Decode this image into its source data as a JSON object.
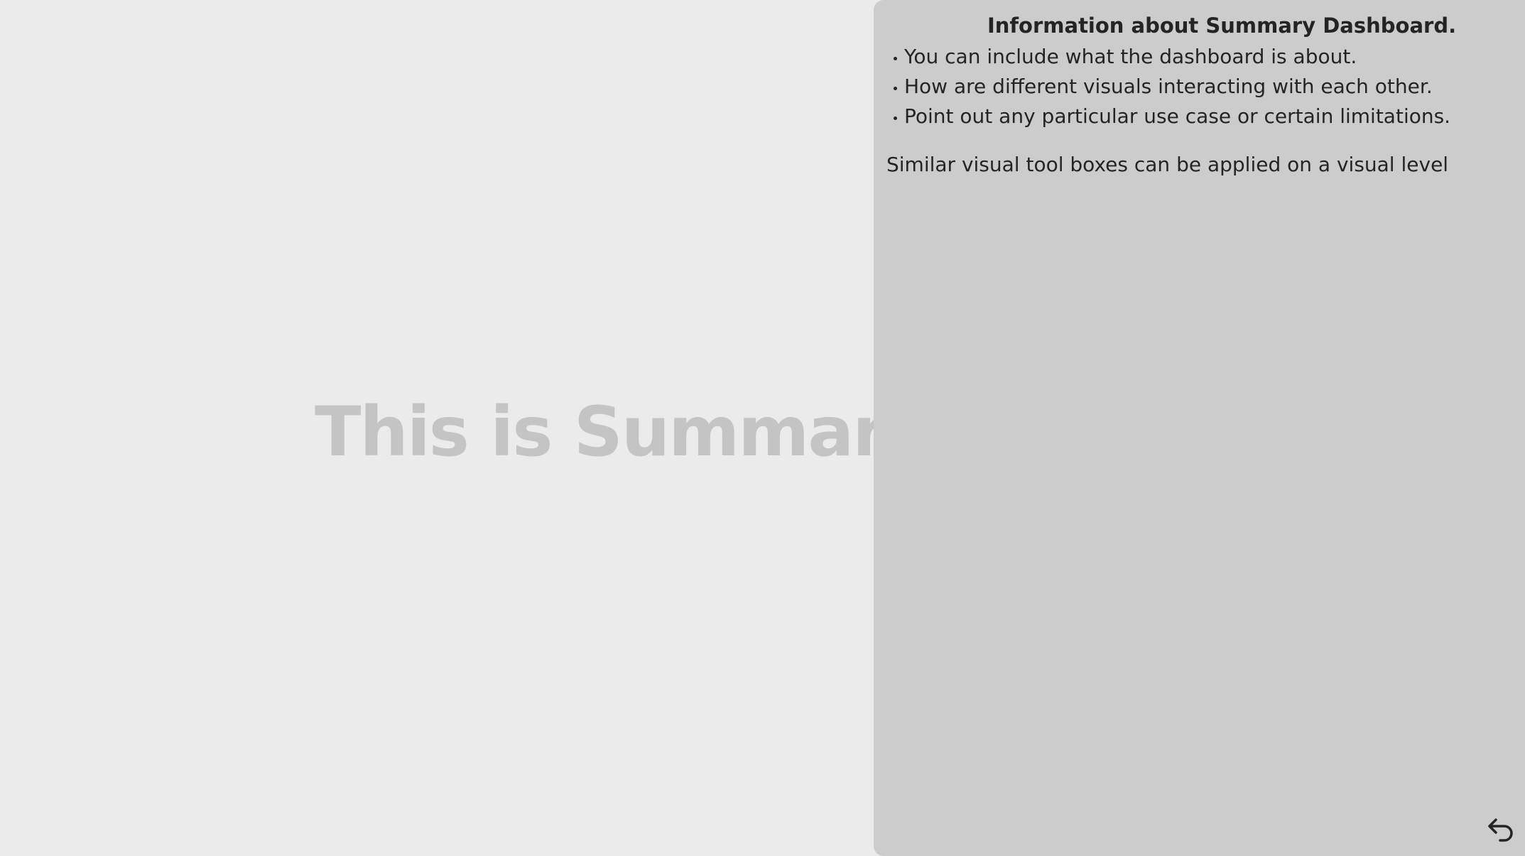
{
  "page": {
    "background_text": "This is Summary D"
  },
  "info_panel": {
    "title": "Information about Summary Dashboard.",
    "bullets": [
      {
        "text": "You can include what the dashboard is about."
      },
      {
        "text": "How are different visuals interacting with each other."
      },
      {
        "text": "Point out any particular use case or certain limitations."
      }
    ],
    "note": "Similar visual tool boxes can be applied on a visual level",
    "back_icon": "back-arrow-icon"
  },
  "colors": {
    "page_bg": "#ebebeb",
    "panel_bg": "#cccccc",
    "title_text": "#c4c4c4",
    "body_text": "#252423"
  }
}
